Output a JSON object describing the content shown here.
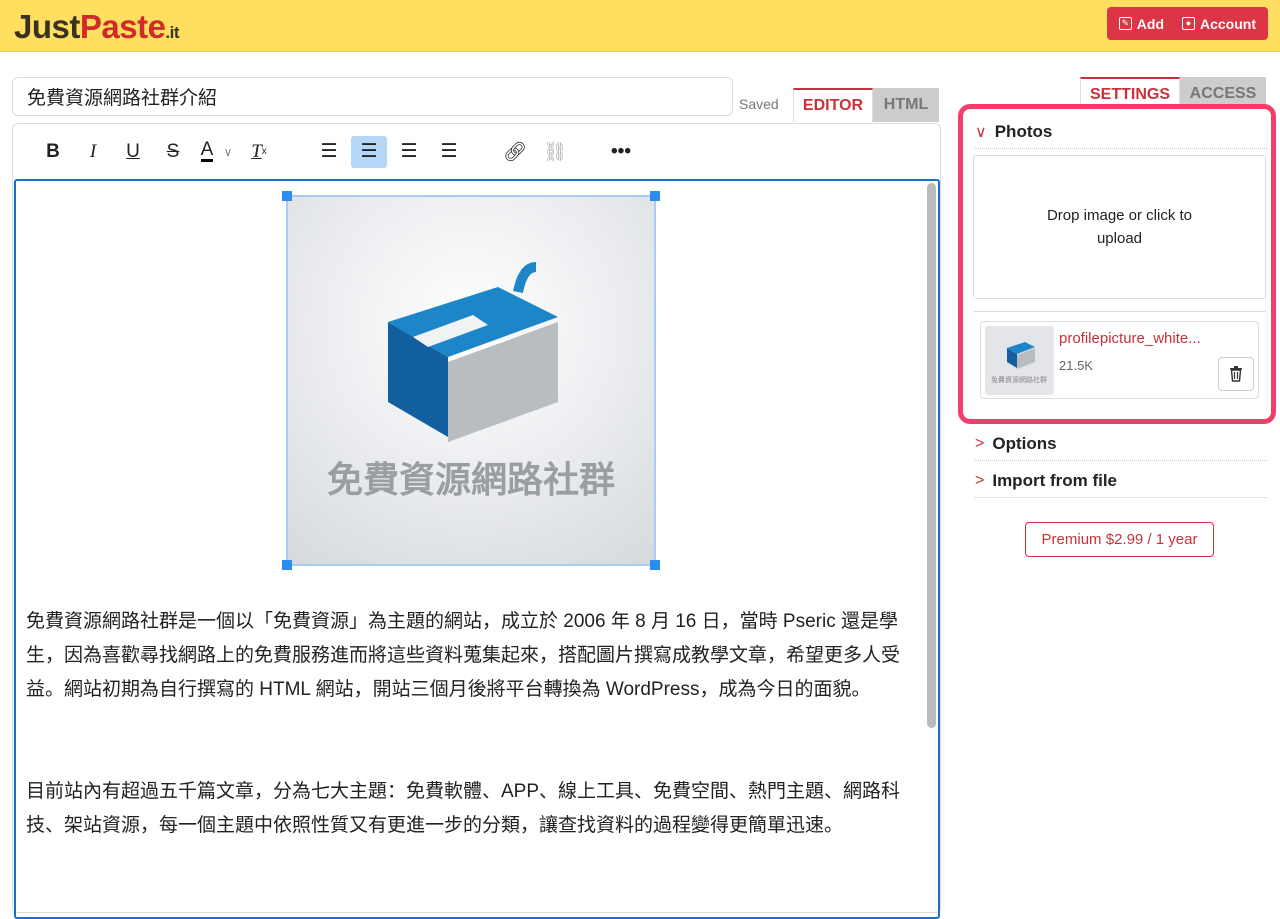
{
  "header": {
    "logo_just": "Just",
    "logo_paste": "Paste",
    "logo_it": ".it",
    "add_label": "Add",
    "account_label": "Account"
  },
  "editor": {
    "title_value": "免費資源網路社群介紹",
    "saved": "Saved",
    "tabs": [
      "EDITOR",
      "HTML"
    ],
    "image_text": "免費資源網路社群",
    "paragraphs": [
      "免費資源網路社群是一個以「免費資源」為主題的網站，成立於 2006 年 8 月 16 日，當時 Pseric 還是學生，因為喜歡尋找網路上的免費服務進而將這些資料蒐集起來，搭配圖片撰寫成教學文章，希望更多人受益。網站初期為自行撰寫的 HTML 網站，開站三個月後將平台轉換為 WordPress，成為今日的面貌。",
      "目前站內有超過五千篇文章，分為七大主題：免費軟體、APP、線上工具、免費空間、熱門主題、網路科技、架站資源，每一個主題中依照性質又有更進一步的分類，讓查找資料的過程變得更簡單迅速。"
    ]
  },
  "sidebar": {
    "tabs": [
      "SETTINGS",
      "ACCESS"
    ],
    "photos_label": "Photos",
    "drop_text": "Drop image or click to upload",
    "file": {
      "name": "profilepicture_white...",
      "size": "21.5K",
      "thumb_text": "免費資源網路社群"
    },
    "options_label": "Options",
    "import_label": "Import from file",
    "premium_label": "Premium $2.99 / 1 year"
  },
  "colors": {
    "header": "#fedf5f",
    "accent": "#c8323a",
    "highlight": "#f23e6a",
    "editor_border": "#1a6fc6"
  }
}
